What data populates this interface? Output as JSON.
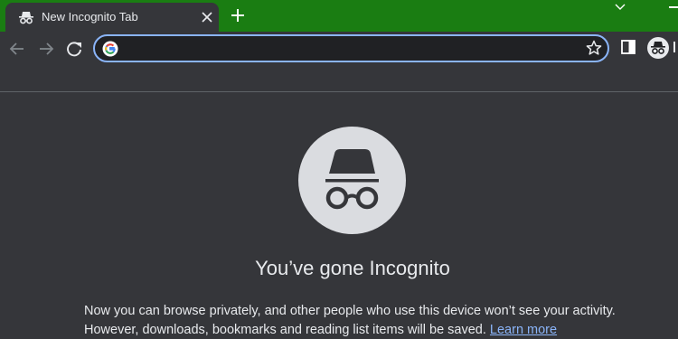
{
  "tab": {
    "title": "New Incognito Tab",
    "favicon": "incognito-icon",
    "close_icon": "close-icon"
  },
  "tabstrip": {
    "new_tab_icon": "plus-icon",
    "dropdown_icon": "chevron-down-icon",
    "minimize_icon": "minimize-icon"
  },
  "toolbar": {
    "back_icon": "arrow-left-icon",
    "forward_icon": "arrow-right-icon",
    "reload_icon": "reload-icon",
    "omnibox": {
      "value": "",
      "placeholder": ""
    },
    "bookmark_icon": "star-icon",
    "side_panel_icon": "side-panel-icon",
    "profile_icon": "incognito-icon"
  },
  "content": {
    "headline": "You’ve gone Incognito",
    "paragraph": "Now you can browse privately, and other people who use this device won’t see your activity. However, downloads, bookmarks and reading list items will be saved.",
    "learn_more": "Learn more"
  },
  "colors": {
    "frame": "#1a7d12",
    "background": "#35363a",
    "omnibox": "#202124",
    "accent": "#8ab4f8"
  }
}
